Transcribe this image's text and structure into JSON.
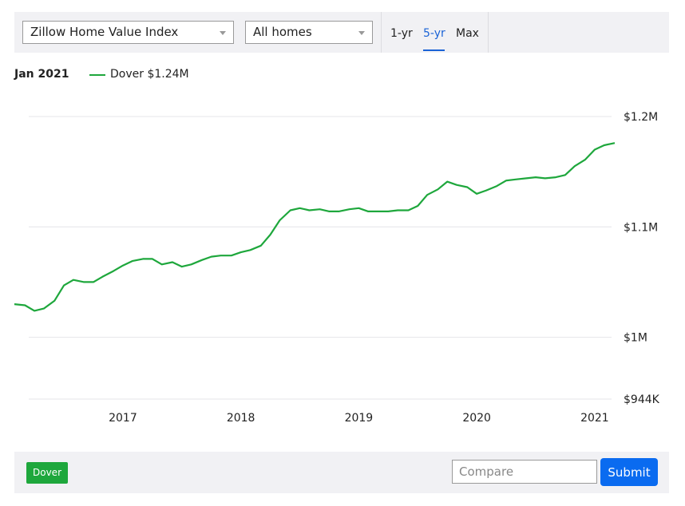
{
  "controls": {
    "index_select": "Zillow Home Value Index",
    "home_type_select": "All homes",
    "tabs": [
      {
        "label": "1-yr",
        "active": false
      },
      {
        "label": "5-yr",
        "active": true
      },
      {
        "label": "Max",
        "active": false
      }
    ]
  },
  "legend": {
    "date": "Jan 2021",
    "series_label": "Dover $1.24M"
  },
  "bottom": {
    "chip_label": "Dover",
    "compare_placeholder": "Compare",
    "submit_label": "Submit"
  },
  "colors": {
    "series": "#1ea73c",
    "accent": "#1a63d6",
    "submit": "#0a6bf0",
    "panel_bg": "#f1f1f4"
  },
  "chart_data": {
    "type": "line",
    "title": "",
    "xlabel": "",
    "ylabel": "",
    "ylim": [
      944000,
      1200000
    ],
    "y_ticks": [
      {
        "value": 1200000,
        "label": "$1.2M"
      },
      {
        "value": 1100000,
        "label": "$1.1M"
      },
      {
        "value": 1000000,
        "label": "$1M"
      },
      {
        "value": 944000,
        "label": "$944K"
      }
    ],
    "xlim": [
      2016.08,
      2021.17
    ],
    "x_ticks": [
      {
        "value": 2017,
        "label": "2017"
      },
      {
        "value": 2018,
        "label": "2018"
      },
      {
        "value": 2019,
        "label": "2019"
      },
      {
        "value": 2020,
        "label": "2020"
      },
      {
        "value": 2021,
        "label": "2021"
      }
    ],
    "grid": true,
    "series": [
      {
        "name": "Dover",
        "color": "#1ea73c",
        "x": [
          2016.08,
          2016.17,
          2016.25,
          2016.33,
          2016.42,
          2016.5,
          2016.58,
          2016.67,
          2016.75,
          2016.83,
          2016.92,
          2017.0,
          2017.08,
          2017.17,
          2017.25,
          2017.33,
          2017.42,
          2017.5,
          2017.58,
          2017.67,
          2017.75,
          2017.83,
          2017.92,
          2018.0,
          2018.08,
          2018.17,
          2018.25,
          2018.33,
          2018.42,
          2018.5,
          2018.58,
          2018.67,
          2018.75,
          2018.83,
          2018.92,
          2019.0,
          2019.08,
          2019.17,
          2019.25,
          2019.33,
          2019.42,
          2019.5,
          2019.58,
          2019.67,
          2019.75,
          2019.83,
          2019.92,
          2020.0,
          2020.08,
          2020.17,
          2020.25,
          2020.33,
          2020.42,
          2020.5,
          2020.58,
          2020.67,
          2020.75,
          2020.83,
          2020.92,
          2021.0,
          2021.08,
          2021.17
        ],
        "y": [
          1030000,
          1029000,
          1024000,
          1026000,
          1033000,
          1047000,
          1052000,
          1050000,
          1050000,
          1055000,
          1060000,
          1065000,
          1069000,
          1071000,
          1071000,
          1066000,
          1068000,
          1064000,
          1066000,
          1070000,
          1073000,
          1074000,
          1074000,
          1077000,
          1079000,
          1083000,
          1093000,
          1106000,
          1115000,
          1117000,
          1115000,
          1116000,
          1114000,
          1114000,
          1116000,
          1117000,
          1114000,
          1114000,
          1114000,
          1115000,
          1115000,
          1119000,
          1129000,
          1134000,
          1141000,
          1138000,
          1136000,
          1130000,
          1133000,
          1137000,
          1142000,
          1143000,
          1144000,
          1145000,
          1144000,
          1145000,
          1147000,
          1155000,
          1161000,
          1170000,
          1174000,
          1176000
        ]
      }
    ]
  }
}
